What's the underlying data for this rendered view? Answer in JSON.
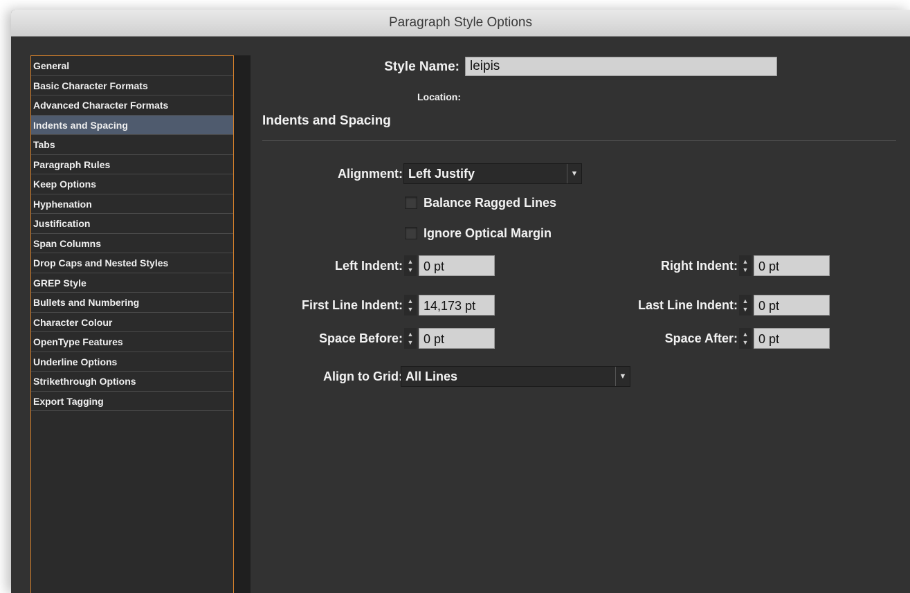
{
  "window": {
    "title": "Paragraph Style Options"
  },
  "sidebar": {
    "items": [
      {
        "label": "General"
      },
      {
        "label": "Basic Character Formats"
      },
      {
        "label": "Advanced Character Formats"
      },
      {
        "label": "Indents and Spacing",
        "selected": true
      },
      {
        "label": "Tabs"
      },
      {
        "label": "Paragraph Rules"
      },
      {
        "label": "Keep Options"
      },
      {
        "label": "Hyphenation"
      },
      {
        "label": "Justification"
      },
      {
        "label": "Span Columns"
      },
      {
        "label": "Drop Caps and Nested Styles"
      },
      {
        "label": "GREP Style"
      },
      {
        "label": "Bullets and Numbering"
      },
      {
        "label": "Character Colour"
      },
      {
        "label": "OpenType Features"
      },
      {
        "label": "Underline Options"
      },
      {
        "label": "Strikethrough Options"
      },
      {
        "label": "Export Tagging"
      }
    ]
  },
  "header": {
    "style_name_label": "Style Name:",
    "style_name_value": "leipis",
    "location_label": "Location:",
    "section_title": "Indents and Spacing"
  },
  "form": {
    "alignment_label": "Alignment:",
    "alignment_value": "Left Justify",
    "balance_ragged_label": "Balance Ragged Lines",
    "ignore_optical_label": "Ignore Optical Margin",
    "left_indent_label": "Left Indent:",
    "left_indent_value": "0 pt",
    "right_indent_label": "Right Indent:",
    "right_indent_value": "0 pt",
    "first_line_indent_label": "First Line Indent:",
    "first_line_indent_value": "14,173 pt",
    "last_line_indent_label": "Last Line Indent:",
    "last_line_indent_value": "0 pt",
    "space_before_label": "Space Before:",
    "space_before_value": "0 pt",
    "space_after_label": "Space After:",
    "space_after_value": "0 pt",
    "align_grid_label": "Align to Grid:",
    "align_grid_value": "All Lines"
  },
  "icons": {
    "dropdown_arrow": "▼",
    "stepper_up": "▲",
    "stepper_down": "▼"
  },
  "colors": {
    "background": "#323232",
    "selected": "#4f5b6e",
    "sidebar_border": "#d9822b"
  }
}
